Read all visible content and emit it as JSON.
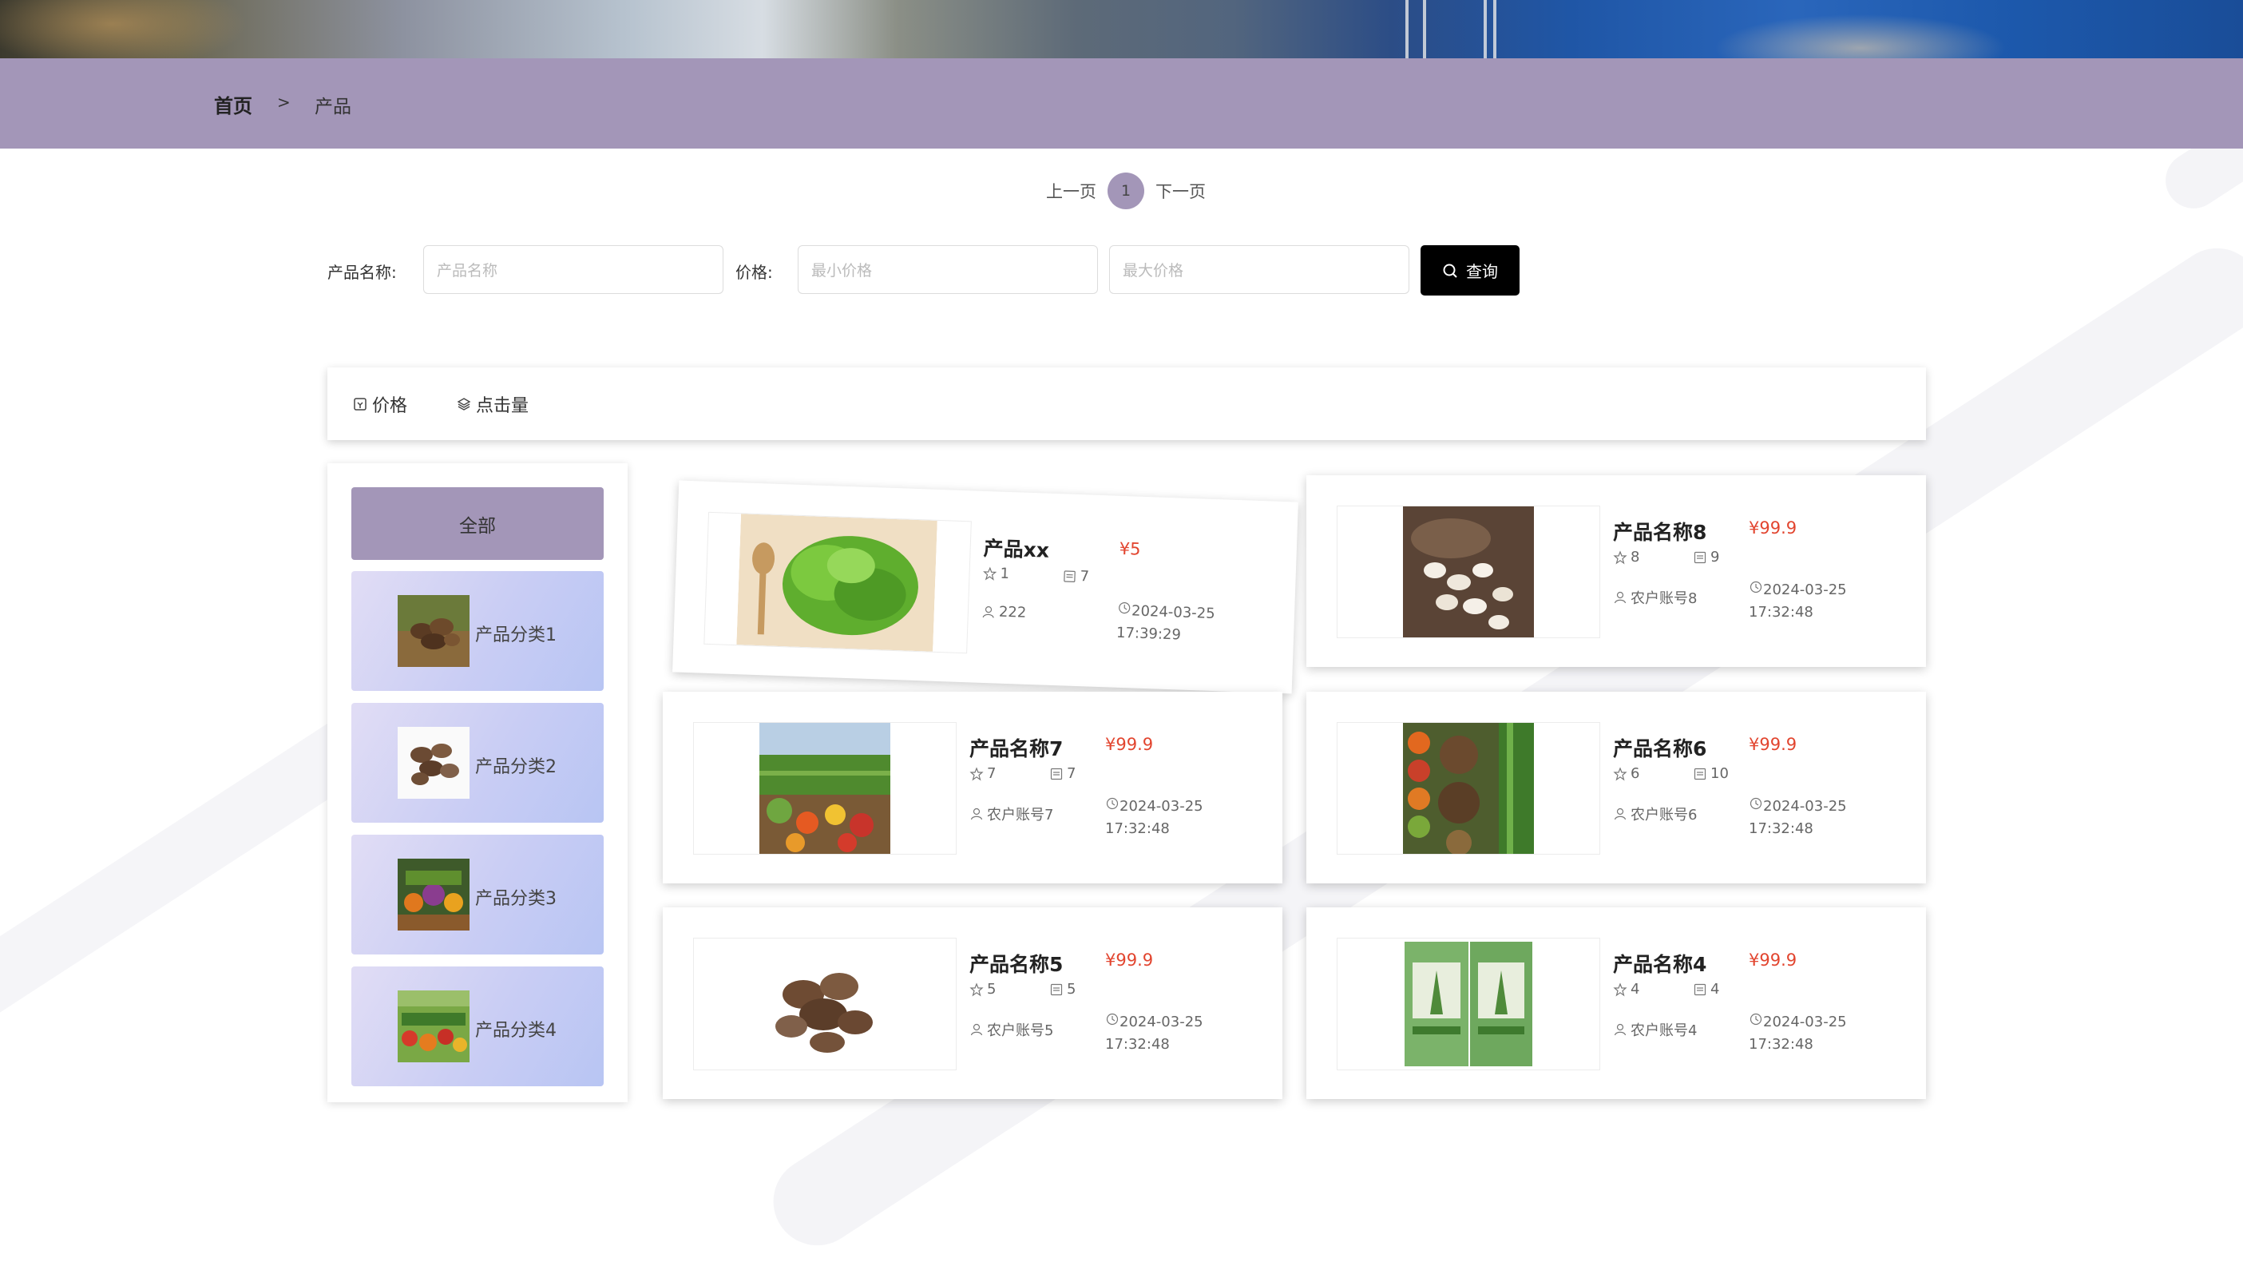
{
  "breadcrumb": {
    "home": "首页",
    "separator": ">",
    "current": "产品"
  },
  "pagination": {
    "prev": "上一页",
    "current": "1",
    "next": "下一页"
  },
  "search": {
    "name_label": "产品名称:",
    "name_placeholder": "产品名称",
    "price_label": "价格:",
    "min_placeholder": "最小价格",
    "max_placeholder": "最大价格",
    "button": "查询"
  },
  "sort": {
    "price": "价格",
    "clicks": "点击量"
  },
  "categories": {
    "all": "全部",
    "items": [
      {
        "label": "产品分类1",
        "icon": "mushroom-basket-image"
      },
      {
        "label": "产品分类2",
        "icon": "mushroom-image"
      },
      {
        "label": "产品分类3",
        "icon": "vegetable-basket-image"
      },
      {
        "label": "产品分类4",
        "icon": "vegetable-stall-image"
      }
    ]
  },
  "products": [
    {
      "name": "产品xx",
      "price": "¥5",
      "favorites": "1",
      "comments": "7",
      "user": "222",
      "date": "2024-03-25",
      "time": "17:39:29",
      "image": "lettuce-image"
    },
    {
      "name": "产品名称8",
      "price": "¥99.9",
      "favorites": "8",
      "comments": "9",
      "user": "农户账号8",
      "date": "2024-03-25",
      "time": "17:32:48",
      "image": "garlic-image"
    },
    {
      "name": "产品名称7",
      "price": "¥99.9",
      "favorites": "7",
      "comments": "7",
      "user": "农户账号7",
      "date": "2024-03-25",
      "time": "17:32:48",
      "image": "vegetable-field-image"
    },
    {
      "name": "产品名称6",
      "price": "¥99.9",
      "favorites": "6",
      "comments": "10",
      "user": "农户账号6",
      "date": "2024-03-25",
      "time": "17:32:48",
      "image": "produce-baskets-image"
    },
    {
      "name": "产品名称5",
      "price": "¥99.9",
      "favorites": "5",
      "comments": "5",
      "user": "农户账号5",
      "date": "2024-03-25",
      "time": "17:32:48",
      "image": "shiitake-image"
    },
    {
      "name": "产品名称4",
      "price": "¥99.9",
      "favorites": "4",
      "comments": "4",
      "user": "农户账号4",
      "date": "2024-03-25",
      "time": "17:32:48",
      "image": "packaged-product-image"
    }
  ],
  "colors": {
    "accent": "#a396b8",
    "price": "#e2452f",
    "button": "#000000"
  }
}
